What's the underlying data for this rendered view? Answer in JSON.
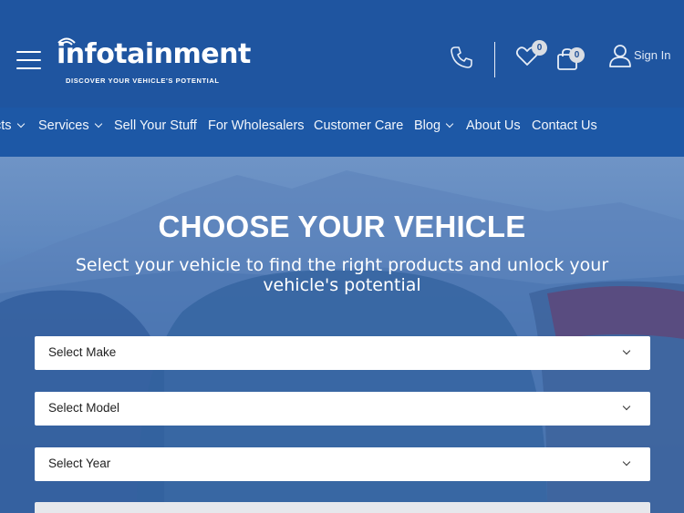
{
  "header": {
    "logo_text": "infotainment",
    "logo_tagline": "DISCOVER YOUR VEHICLE'S POTENTIAL",
    "wishlist_count": "0",
    "cart_count": "0",
    "sign_in_label": "Sign In",
    "icons": [
      "menu-icon",
      "phone-icon",
      "heart-icon",
      "shopping-bag-icon",
      "user-icon"
    ]
  },
  "nav": {
    "items": [
      {
        "label": "cts",
        "has_dropdown": true
      },
      {
        "label": "Services",
        "has_dropdown": true
      },
      {
        "label": "Sell Your Stuff",
        "has_dropdown": false
      },
      {
        "label": "For Wholesalers",
        "has_dropdown": false
      },
      {
        "label": "Customer Care",
        "has_dropdown": false
      },
      {
        "label": "Blog",
        "has_dropdown": true
      },
      {
        "label": "About Us",
        "has_dropdown": false
      },
      {
        "label": "Contact Us",
        "has_dropdown": false
      }
    ]
  },
  "hero": {
    "title": "CHOOSE YOUR VEHICLE",
    "subtitle": "Select your vehicle to find the right products and unlock your vehicle's potential",
    "selects": [
      {
        "placeholder": "Select Make"
      },
      {
        "placeholder": "Select Model"
      },
      {
        "placeholder": "Select Year"
      }
    ]
  },
  "colors": {
    "header_bg": "#1f55a0",
    "nav_bg": "#1d58a6",
    "hero_tint": "#3d6aa8",
    "text_light": "#ffffff"
  }
}
